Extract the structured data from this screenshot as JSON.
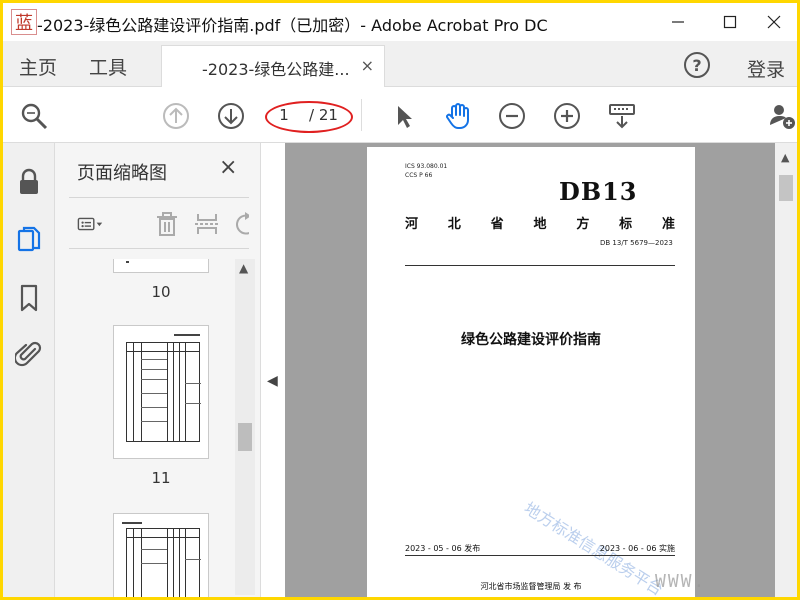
{
  "window": {
    "title": "-2023-绿色公路建设评价指南.pdf（已加密）- Adobe Acrobat Pro DC",
    "logo_text": "蓝",
    "controls": [
      "minimize-icon",
      "maximize-icon",
      "close-icon"
    ]
  },
  "tabs": {
    "home": "主页",
    "tools": "工具",
    "document": "-2023-绿色公路建...",
    "document_close": "×",
    "login": "登录"
  },
  "toolbar": {
    "current_page": "1",
    "total_pages": "/ 21",
    "icons": [
      "search-zoom-icon",
      "prev-page-icon",
      "next-page-icon",
      "select-cursor-icon",
      "hand-tool-icon",
      "zoom-out-icon",
      "zoom-in-icon",
      "keyboard-tools-icon",
      "add-user-icon"
    ]
  },
  "sidebar": {
    "icons": [
      "lock-icon",
      "pages-icon",
      "bookmark-icon",
      "attachment-icon"
    ]
  },
  "thumbnail_panel": {
    "title": "页面缩略图",
    "close": "×",
    "pages": [
      {
        "label": "10"
      },
      {
        "label": "11"
      },
      {
        "label": ""
      }
    ]
  },
  "document_page": {
    "ics": "ICS  93.080.01",
    "ccs": "CCS  P 66",
    "db_label": "DB13",
    "province_chars": [
      "河",
      "北",
      "省",
      "地",
      "方",
      "标",
      "准"
    ],
    "standard_no": "DB 13/T 5679—2023",
    "title": "绿色公路建设评价指南",
    "watermark": "地方标准信息服务平台",
    "publish_date": "2023 - 05 - 06 发布",
    "implement_date": "2023 - 06 - 06 实施",
    "issuer": "河北省市场监督管理局    发  布"
  },
  "overlay": {
    "www": "WWW."
  },
  "colors": {
    "frame": "#ffd700",
    "annotation_circle": "#e02020",
    "active_icon": "#1473e6",
    "doc_background": "#a0a0a0"
  }
}
